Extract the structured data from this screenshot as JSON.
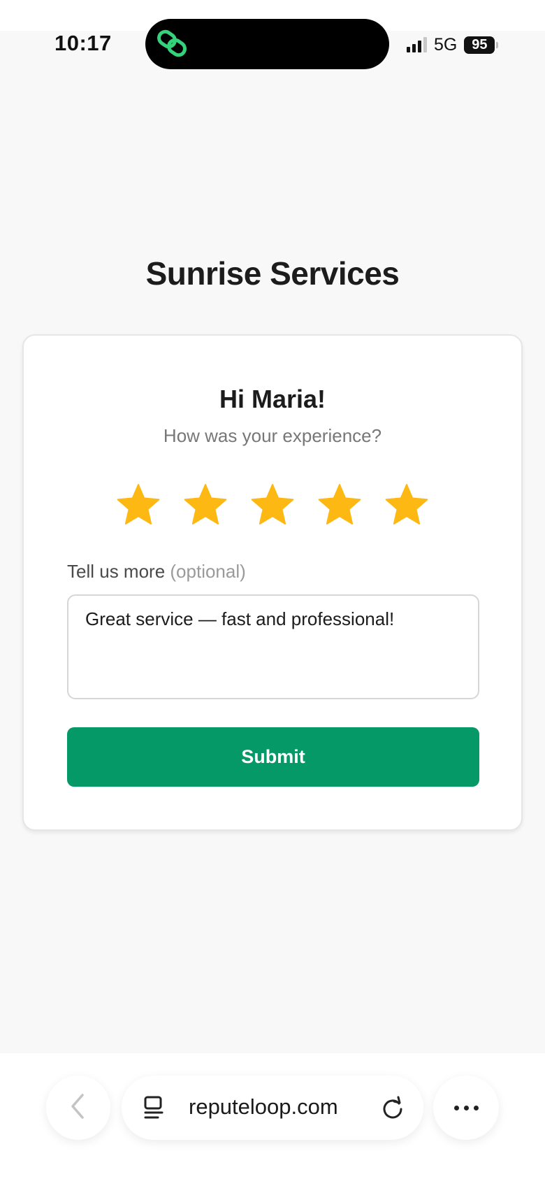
{
  "status_bar": {
    "time": "10:17",
    "network": "5G",
    "battery": "95"
  },
  "page": {
    "business_name": "Sunrise Services",
    "greeting": "Hi Maria!",
    "prompt": "How was your experience?",
    "rating": {
      "value": 5,
      "max": 5,
      "color": "#FDB813"
    },
    "feedback_label": "Tell us more",
    "feedback_optional": "(optional)",
    "feedback_text": "Great service — fast and professional!",
    "submit_label": "Submit",
    "submit_color": "#069968"
  },
  "browser": {
    "url": "reputeloop.com",
    "icons": [
      "back-chevron-icon",
      "tabs-icon",
      "reload-icon",
      "more-dots-icon"
    ]
  }
}
